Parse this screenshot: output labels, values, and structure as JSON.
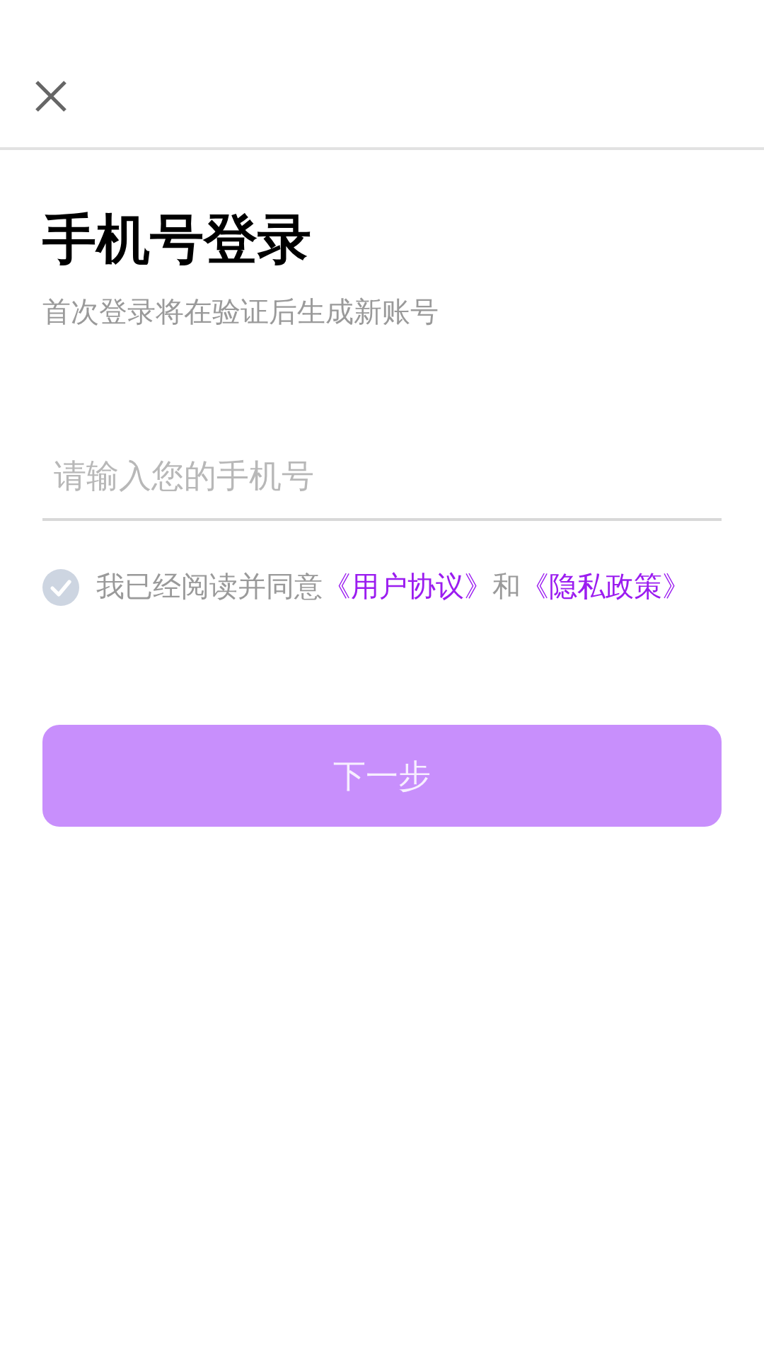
{
  "title": "手机号登录",
  "subtitle": "首次登录将在验证后生成新账号",
  "phone_field": {
    "placeholder": "请输入您的手机号"
  },
  "agreement": {
    "checked": false,
    "parts": [
      {
        "kind": "text",
        "text": "我已经阅读并同意"
      },
      {
        "kind": "link",
        "text": "《用户协议》"
      },
      {
        "kind": "text",
        "text": "和"
      },
      {
        "kind": "link",
        "text": "《隐私政策》"
      }
    ]
  },
  "next_button": {
    "label": "下一步",
    "disabled": true
  }
}
